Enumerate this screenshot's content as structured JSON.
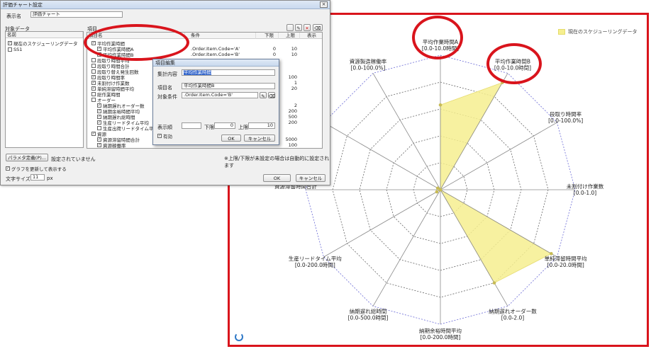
{
  "dialog": {
    "title": "評価チャート設定",
    "close": "×",
    "name_label": "表示名",
    "name_value": "評価チャート",
    "target_label": "対象データ",
    "target_header": "名前",
    "targets": [
      {
        "label": "現在のスケジューリングデータ",
        "checked": true
      },
      {
        "label": "SS1",
        "checked": false
      }
    ],
    "items_label": "項目",
    "columns": [
      "項目名",
      "条件",
      "下限",
      "上限",
      "表示"
    ],
    "tree": [
      {
        "indent": 0,
        "label": "平均作業時間",
        "checked": true,
        "cond": "",
        "lo": "",
        "hi": ""
      },
      {
        "indent": 1,
        "label": "平均作業時間A",
        "checked": true,
        "cond": ".Order.Item.Code='A'",
        "lo": "0",
        "hi": "10"
      },
      {
        "indent": 1,
        "label": "平均作業時間B",
        "checked": true,
        "cond": ".Order.Item.Code='B'",
        "lo": "0",
        "hi": "10"
      },
      {
        "indent": 0,
        "label": "段取り時間平均",
        "checked": false,
        "cond": "",
        "lo": "",
        "hi": ""
      },
      {
        "indent": 0,
        "label": "段取り時間合計",
        "checked": false,
        "cond": "",
        "lo": "",
        "hi": ""
      },
      {
        "indent": 0,
        "label": "段取り替え発生回数",
        "checked": false,
        "cond": "",
        "lo": "",
        "hi": ""
      },
      {
        "indent": 0,
        "label": "段取り時間率",
        "checked": true,
        "cond": "",
        "lo": "",
        "hi": "100"
      },
      {
        "indent": 0,
        "label": "未割付け作業数",
        "checked": true,
        "cond": "",
        "lo": "",
        "hi": "1"
      },
      {
        "indent": 0,
        "label": "単純滞留時間平均",
        "checked": true,
        "cond": "",
        "lo": "",
        "hi": "20"
      },
      {
        "indent": 0,
        "label": "総作業時間",
        "checked": false,
        "cond": "",
        "lo": "",
        "hi": ""
      },
      {
        "indent": 0,
        "label": "オーダー",
        "checked": false,
        "cond": "",
        "lo": "",
        "hi": ""
      },
      {
        "indent": 1,
        "label": "納期遅れオーダー数",
        "checked": true,
        "cond": "",
        "lo": "",
        "hi": "2"
      },
      {
        "indent": 1,
        "label": "納期余裕時間平均",
        "checked": true,
        "cond": "",
        "lo": "",
        "hi": "200"
      },
      {
        "indent": 1,
        "label": "納期遅れ総時間",
        "checked": true,
        "cond": "",
        "lo": "",
        "hi": "500"
      },
      {
        "indent": 1,
        "label": "生産リードタイム平均",
        "checked": true,
        "cond": "",
        "lo": "",
        "hi": "200"
      },
      {
        "indent": 1,
        "label": "生産出荷リードタイム平均",
        "checked": false,
        "cond": "",
        "lo": "",
        "hi": ""
      },
      {
        "indent": 0,
        "label": "資源",
        "checked": true,
        "cond": "",
        "lo": "",
        "hi": ""
      },
      {
        "indent": 1,
        "label": "資源滞留時間合計",
        "checked": true,
        "cond": "",
        "lo": "",
        "hi": "5000"
      },
      {
        "indent": 1,
        "label": "資源稼働率",
        "checked": true,
        "cond": "",
        "lo": "",
        "hi": "100"
      }
    ],
    "note": "※上限/下限が未設定の場合は自動的に設定されます",
    "param_button": "パラメタ定義(P)...",
    "param_status": "設定されていません",
    "update_check": "グラフを更新して表示する",
    "font_size_label": "文字サイズ",
    "font_size_value": "11",
    "font_size_unit": "px",
    "ok": "OK",
    "cancel": "キャンセル"
  },
  "subdialog": {
    "title": "項目編集",
    "calc_label": "集計内容",
    "calc_value": "平均作業時間",
    "name_label": "項目名",
    "name_value": "平均作業時間B",
    "cond_label": "対象条件",
    "cond_value": ".Order.Item.Code='B'",
    "order_label": "表示順",
    "lo_label": "下限",
    "lo_value": "0",
    "hi_label": "上限",
    "hi_value": "10",
    "enabled_label": "有効",
    "ok": "OK",
    "cancel": "キャンセル"
  },
  "chart_data": {
    "type": "radar",
    "legend": "現在のスケジューリングデータ",
    "legend_position": "top-right",
    "fill_color": "#f6ef8f",
    "point_color": "#c7bb55",
    "axes": [
      {
        "name": "平均作業時間A",
        "range": "[0.0-10.0時間]",
        "min": 0,
        "max": 10,
        "value": 6.3
      },
      {
        "name": "平均作業時間B",
        "range": "[0.0-10.0時間]",
        "min": 0,
        "max": 10,
        "value": 9.2
      },
      {
        "name": "段取り時間率",
        "range": "[0.0-100.0%]",
        "min": 0,
        "max": 100,
        "value": 0
      },
      {
        "name": "未割付け作業数",
        "range": "[0.0-1.0]",
        "min": 0,
        "max": 1,
        "value": 0
      },
      {
        "name": "単純滞留時間平均",
        "range": "[0.0-20.0時間]",
        "min": 0,
        "max": 20,
        "value": 19
      },
      {
        "name": "納期遅れオーダー数",
        "range": "[0.0-2.0]",
        "min": 0,
        "max": 2,
        "value": 1.6
      },
      {
        "name": "納期余裕時間平均",
        "range": "[0.0-200.0時間]",
        "min": 0,
        "max": 200,
        "value": 0
      },
      {
        "name": "納期遅れ総時間",
        "range": "[0.0-500.0時間]",
        "min": 0,
        "max": 500,
        "value": 0
      },
      {
        "name": "生産リードタイム平均",
        "range": "[0.0-200.0時間]",
        "min": 0,
        "max": 200,
        "value": 6.2
      },
      {
        "name": "資源滞留時間合計",
        "range": "",
        "min": 0,
        "max": 5000,
        "value": 1.2
      },
      {
        "name": "資源稼働率",
        "range": "",
        "min": 0,
        "max": 100,
        "value": 2.3
      },
      {
        "name": "資源製造稼働率",
        "range": "[0.0-100.0%]",
        "min": 0,
        "max": 100,
        "value": 0
      }
    ],
    "grid_rings": 5
  },
  "annotation_color": "#d9141c"
}
